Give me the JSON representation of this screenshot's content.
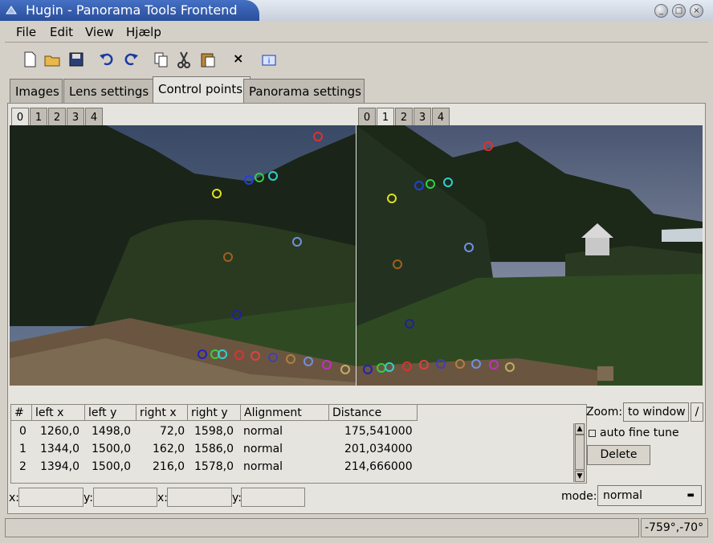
{
  "window": {
    "title": "Hugin - Panorama Tools Frontend"
  },
  "menu": [
    "File",
    "Edit",
    "View",
    "Hjælp"
  ],
  "toolbar": [
    "new-icon",
    "open-icon",
    "save-icon",
    "undo-icon",
    "redo-icon",
    "copy-icon",
    "cut-icon",
    "paste-icon",
    "close-icon",
    "info-icon"
  ],
  "tabs": [
    "Images",
    "Lens settings",
    "Control points",
    "Panorama settings"
  ],
  "active_tab": "Control points",
  "left_image_tabs": [
    "0",
    "1",
    "2",
    "3",
    "4"
  ],
  "right_image_tabs": [
    "0",
    "1",
    "2",
    "3",
    "4"
  ],
  "left_image_active": "0",
  "right_image_active": "1",
  "table": {
    "headers": [
      "#",
      "left x",
      "left y",
      "right x",
      "right y",
      "Alignment",
      "Distance"
    ],
    "rows": [
      [
        "0",
        "1260,0",
        "1498,0",
        "72,0",
        "1598,0",
        "normal",
        "175,541000"
      ],
      [
        "1",
        "1344,0",
        "1500,0",
        "162,0",
        "1586,0",
        "normal",
        "201,034000"
      ],
      [
        "2",
        "1394,0",
        "1500,0",
        "216,0",
        "1578,0",
        "normal",
        "214,666000"
      ]
    ]
  },
  "zoom": {
    "label": "Zoom:",
    "value": "to window",
    "button": "/"
  },
  "auto_fine_tune": {
    "label": "auto fine tune",
    "checked": false
  },
  "delete_button": "Delete",
  "coords": {
    "x1": "x:",
    "y1": "y:",
    "x2": "x:",
    "y2": "y:"
  },
  "mode": {
    "label": "mode:",
    "value": "normal"
  },
  "status": {
    "left": "",
    "right": "-759°,-70°"
  },
  "colors": {
    "accent": "#3160b8",
    "panel": "#e6e4df",
    "chrome": "#d4d0c8"
  }
}
